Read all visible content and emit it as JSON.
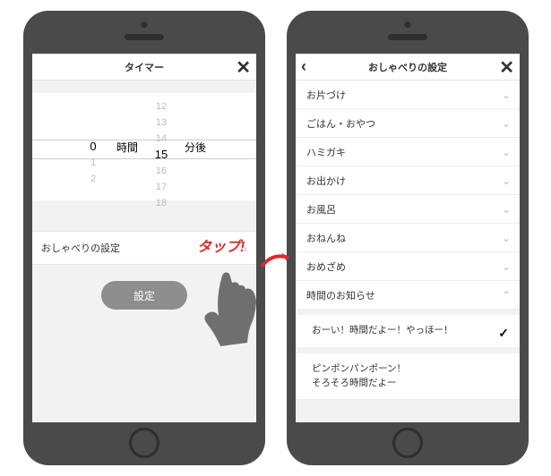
{
  "left": {
    "header": {
      "title": "タイマー",
      "close": "✕"
    },
    "picker": {
      "hours_above": [
        "",
        "",
        ""
      ],
      "hours_selected": "0",
      "hours_below": [
        "1",
        "2",
        ""
      ],
      "hours_label": "時間",
      "mins_above": [
        "12",
        "13",
        "14"
      ],
      "mins_selected": "15",
      "mins_below": [
        "16",
        "17",
        "18"
      ],
      "mins_suffix": "分後"
    },
    "talk_row": {
      "label": "おしゃべりの設定",
      "chev": "›"
    },
    "set_button": "設定"
  },
  "right": {
    "header": {
      "title": "おしゃべりの設定",
      "back": "‹",
      "close": "✕"
    },
    "items": [
      {
        "label": "お片づけ",
        "expanded": false
      },
      {
        "label": "ごはん・おやつ",
        "expanded": false
      },
      {
        "label": "ハミガキ",
        "expanded": false
      },
      {
        "label": "お出かけ",
        "expanded": false
      },
      {
        "label": "お風呂",
        "expanded": false
      },
      {
        "label": "おねんね",
        "expanded": false
      },
      {
        "label": "おめざめ",
        "expanded": false
      },
      {
        "label": "時間のお知らせ",
        "expanded": true
      }
    ],
    "sub_options": [
      {
        "label": "おーい！時間だよー！やっほー！",
        "selected": true
      },
      {
        "label": "ピンポンパンポーン！\nそろそろ時間だよー",
        "selected": false
      }
    ]
  },
  "annotation": {
    "tap": "タップ!"
  }
}
